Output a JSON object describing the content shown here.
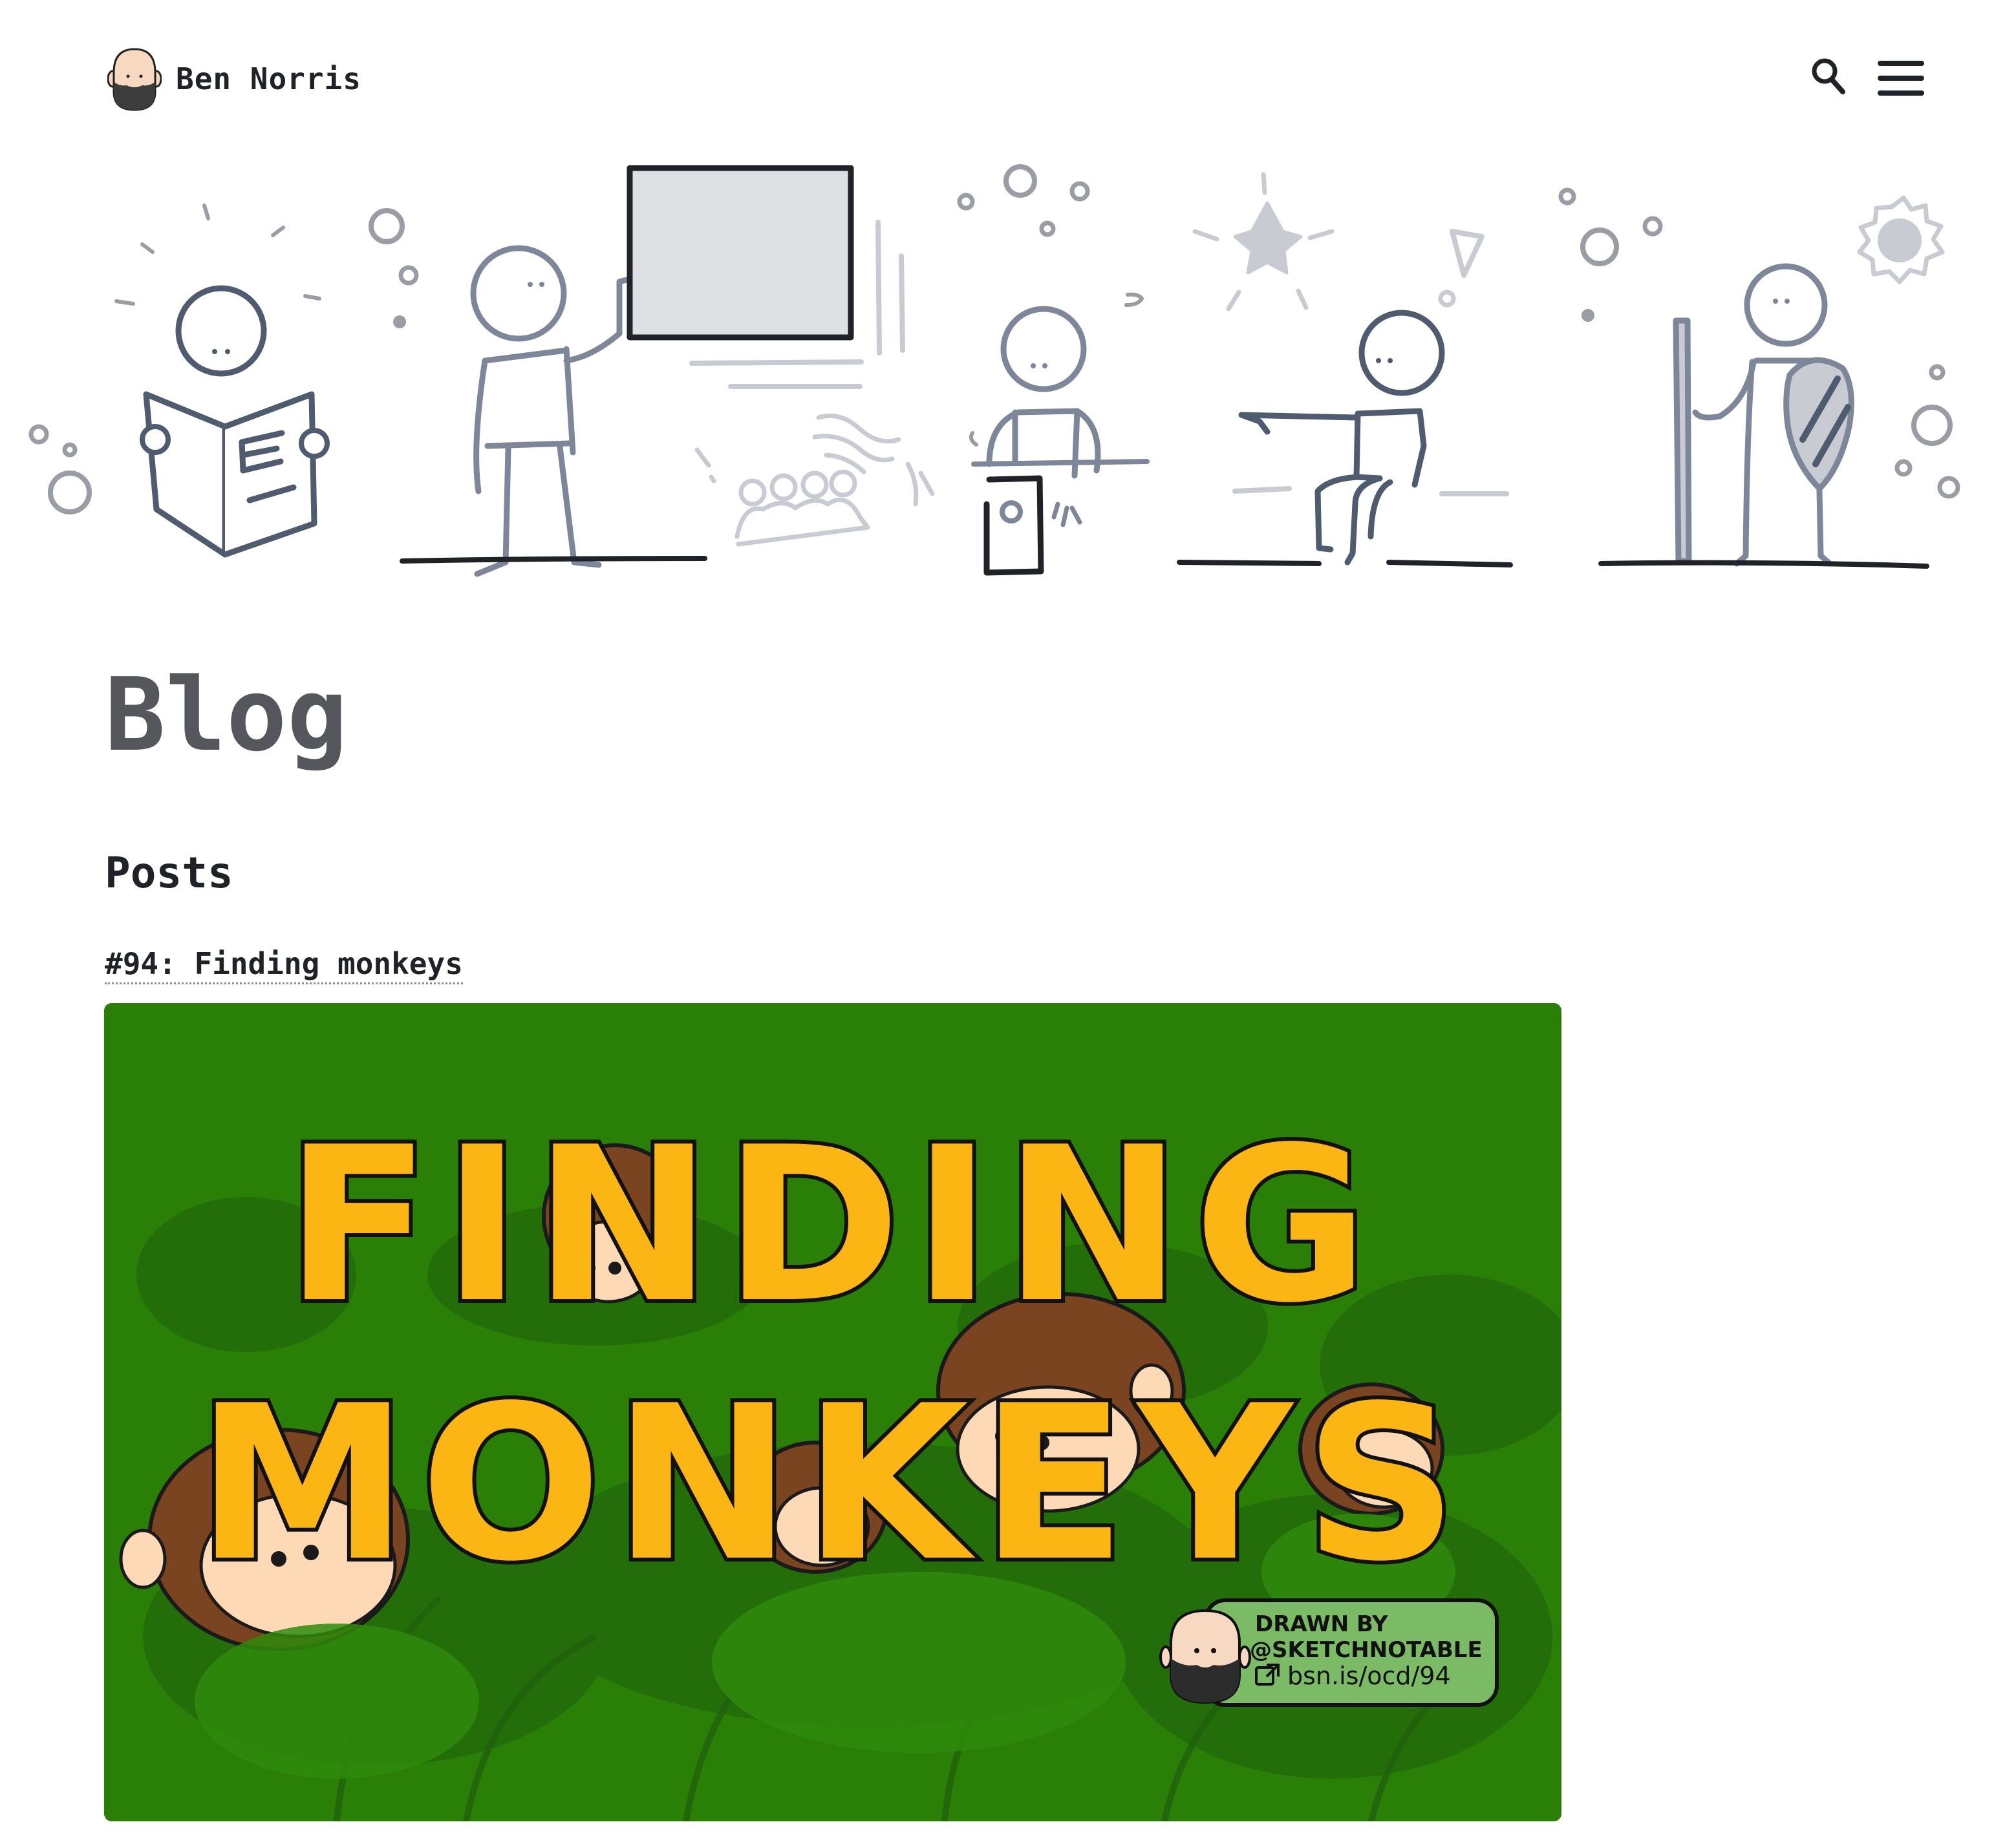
{
  "site": {
    "name": "Ben Norris",
    "logo_icon": "bearded-face-avatar-icon",
    "search_icon": "search-icon",
    "menu_icon": "hamburger-menu-icon"
  },
  "page": {
    "title": "Blog"
  },
  "posts_section": {
    "title": "Posts",
    "posts": [
      {
        "title": "#94: Finding monkeys",
        "image": {
          "headline_line1": "FINDING",
          "headline_line2": "MONKEYS",
          "credit_line1": "DRAWN BY",
          "credit_line2": "@SKETCHNOTABLE",
          "credit_line3": "bsn.is/ocd/94"
        }
      }
    ]
  },
  "colors": {
    "text": "#1f2226",
    "title_gray": "#55575d",
    "jungle_green": "#2a7f07",
    "letter_yellow": "#fbb613",
    "credit_green": "#7bbb66"
  }
}
